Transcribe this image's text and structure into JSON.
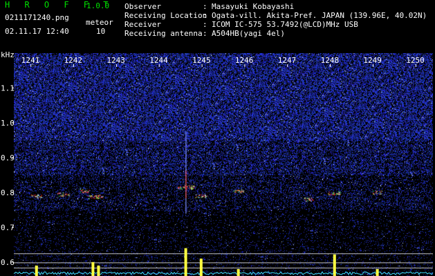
{
  "header": {
    "app_title": "H R O F F T",
    "app_version": "1.0.0",
    "filename": "0211171240.png",
    "datetime": "02.11.17 12:40",
    "meteor_label": "meteor",
    "meteor_count": "10",
    "fields": [
      {
        "label": "Observer",
        "value": "Masayuki Kobayashi"
      },
      {
        "label": "Receiving Location",
        "value": "Ogata-vill. Akita-Pref. JAPAN (139.96E, 40.02N)"
      },
      {
        "label": "Receiver",
        "value": "ICOM IC-575 53.7492(@LCD)MHz USB"
      },
      {
        "label": "Receiving antenna",
        "value": "A504HB(yagi 4el)"
      }
    ]
  },
  "chart_data": {
    "type": "heatmap",
    "title": "",
    "ylabel": "kHz",
    "xlabel": "",
    "x_ticks": [
      "1241",
      "1242",
      "1243",
      "1244",
      "1245",
      "1246",
      "1247",
      "1248",
      "1249",
      "1250"
    ],
    "y_ticks": [
      "1.1",
      "1.0",
      "0.9",
      "0.8",
      "0.7",
      "0.6"
    ],
    "xlim": [
      1240.6,
      1250.4
    ],
    "ylim": [
      0.56,
      1.2
    ],
    "grid": false,
    "colors": {
      "background": "#000000",
      "noise": "#1a2ad8",
      "echo": "#ff3030",
      "level_bars": "#ffff40",
      "noise_floor": "#40e0ff",
      "threshold_lines": "#c0c0c0"
    },
    "echoes": [
      {
        "time": 1241.12,
        "freq": 0.79,
        "strength": 0.5
      },
      {
        "time": 1241.75,
        "freq": 0.795,
        "strength": 0.6
      },
      {
        "time": 1242.25,
        "freq": 0.805,
        "strength": 0.55
      },
      {
        "time": 1242.5,
        "freq": 0.788,
        "strength": 0.95
      },
      {
        "time": 1244.62,
        "freq": 0.815,
        "strength": 1.0
      },
      {
        "time": 1244.98,
        "freq": 0.79,
        "strength": 0.6
      },
      {
        "time": 1245.85,
        "freq": 0.805,
        "strength": 0.5
      },
      {
        "time": 1247.5,
        "freq": 0.78,
        "strength": 0.5
      },
      {
        "time": 1248.1,
        "freq": 0.798,
        "strength": 0.75
      },
      {
        "time": 1249.1,
        "freq": 0.8,
        "strength": 0.4
      }
    ],
    "threshold_levels": [
      0.624,
      0.598,
      0.583
    ],
    "level_peaks": [
      {
        "time": 1241.13,
        "level": 0.59
      },
      {
        "time": 1242.45,
        "level": 0.6
      },
      {
        "time": 1242.58,
        "level": 0.59
      },
      {
        "time": 1244.62,
        "level": 0.64
      },
      {
        "time": 1244.98,
        "level": 0.61
      },
      {
        "time": 1245.85,
        "level": 0.58
      },
      {
        "time": 1248.1,
        "level": 0.622
      },
      {
        "time": 1249.1,
        "level": 0.58
      }
    ],
    "head_meteor": {
      "time": 1244.62,
      "freq_top": 0.975,
      "freq_bottom": 0.74
    }
  }
}
